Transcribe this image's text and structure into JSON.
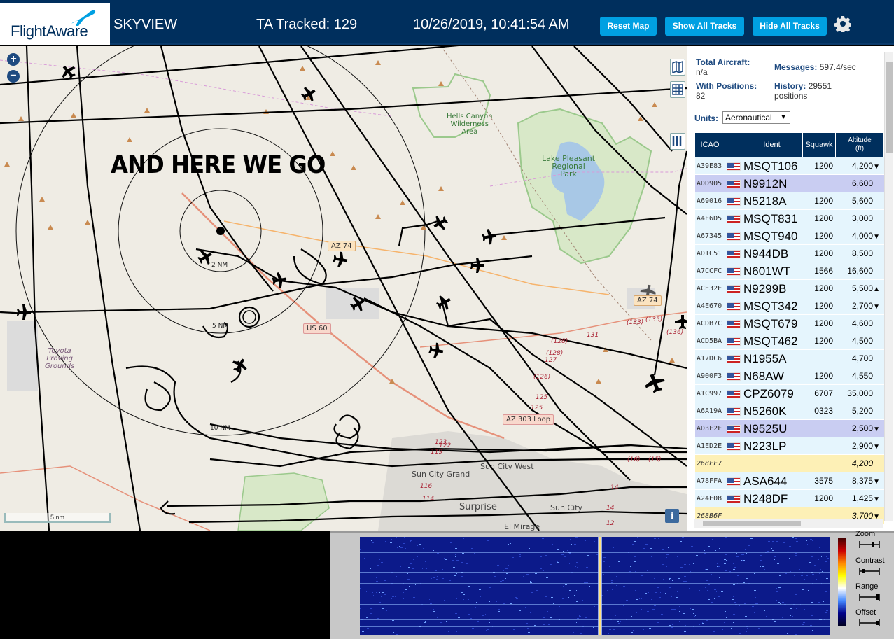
{
  "header": {
    "logo_text": "FlightAware",
    "app_name": "SKYVIEW",
    "tracked": "TA Tracked: 129",
    "clock": "10/26/2019, 10:41:54 AM",
    "btn_reset": "Reset Map",
    "btn_show": "Show All Tracks",
    "btn_hide": "Hide All Tracks",
    "settings_icon": "gear-icon"
  },
  "map": {
    "overlay_text": "AND HERE WE GO",
    "zoom_in": "+",
    "zoom_out": "−",
    "scale_label": "5 nm",
    "info_label": "i",
    "labels": {
      "hells_canyon": "Hells Canyon\nWilderness\nArea",
      "lake_pleasant": "Lake Pleasant\nRegional\nPark",
      "toyota": "Toyota\nProving\nGrounds",
      "sun_city_grand": "Sun City Grand",
      "sun_city_west": "Sun City West",
      "surprise": "Surprise",
      "sun_city": "Sun City",
      "el_mirage": "El Mirage"
    },
    "shields": {
      "az74": "AZ 74",
      "us60": "US 60",
      "az303": "AZ 303 Loop",
      "az74b": "AZ 74"
    },
    "rings": [
      "2 NM",
      "5 NM",
      "10 NM"
    ],
    "exits": [
      "(128)",
      "(128)",
      "127",
      "(126)",
      "125",
      "125",
      "(133)",
      "(135)",
      "(136)",
      "131",
      "123",
      "122",
      "119",
      "116",
      "114",
      "14",
      "14",
      "12",
      "(16)",
      "(15)"
    ]
  },
  "sidebar": {
    "total_aircraft_label": "Total Aircraft:",
    "total_aircraft_value": "n/a",
    "messages_label": "Messages:",
    "messages_value": "597.4/sec",
    "with_positions_label": "With Positions:",
    "with_positions_value": "82",
    "history_label": "History:",
    "history_value": "29551",
    "history_unit": "positions",
    "units_label": "Units:",
    "units_value": "Aeronautical",
    "columns": [
      "ICAO",
      "",
      "Ident",
      "Squawk",
      "Altitude\n(ft)"
    ],
    "rows": [
      {
        "icao": "A39E83",
        "ident": "MSQT106",
        "squawk": "1200",
        "alt": "4,200",
        "trend": "▼",
        "style": ""
      },
      {
        "icao": "ADD905",
        "ident": "N9912N",
        "squawk": "",
        "alt": "6,600",
        "trend": "",
        "style": "sel"
      },
      {
        "icao": "A69016",
        "ident": "N5218A",
        "squawk": "1200",
        "alt": "5,600",
        "trend": "",
        "style": ""
      },
      {
        "icao": "A4F6D5",
        "ident": "MSQT831",
        "squawk": "1200",
        "alt": "3,000",
        "trend": "",
        "style": ""
      },
      {
        "icao": "A67345",
        "ident": "MSQT940",
        "squawk": "1200",
        "alt": "4,000",
        "trend": "▼",
        "style": ""
      },
      {
        "icao": "AD1C51",
        "ident": "N944DB",
        "squawk": "1200",
        "alt": "8,500",
        "trend": "",
        "style": ""
      },
      {
        "icao": "A7CCFC",
        "ident": "N601WT",
        "squawk": "1566",
        "alt": "16,600",
        "trend": "",
        "style": ""
      },
      {
        "icao": "ACE32E",
        "ident": "N9299B",
        "squawk": "1200",
        "alt": "5,500",
        "trend": "▲",
        "style": ""
      },
      {
        "icao": "A4E670",
        "ident": "MSQT342",
        "squawk": "1200",
        "alt": "2,700",
        "trend": "▼",
        "style": ""
      },
      {
        "icao": "ACDB7C",
        "ident": "MSQT679",
        "squawk": "1200",
        "alt": "4,600",
        "trend": "",
        "style": ""
      },
      {
        "icao": "ACD5BA",
        "ident": "MSQT462",
        "squawk": "1200",
        "alt": "4,500",
        "trend": "",
        "style": ""
      },
      {
        "icao": "A17DC6",
        "ident": "N1955A",
        "squawk": "",
        "alt": "4,700",
        "trend": "",
        "style": ""
      },
      {
        "icao": "A900F3",
        "ident": "N68AW",
        "squawk": "1200",
        "alt": "4,550",
        "trend": "",
        "style": ""
      },
      {
        "icao": "A1C997",
        "ident": "CPZ6079",
        "squawk": "6707",
        "alt": "35,000",
        "trend": "",
        "style": ""
      },
      {
        "icao": "A6A19A",
        "ident": "N5260K",
        "squawk": "0323",
        "alt": "5,200",
        "trend": "",
        "style": ""
      },
      {
        "icao": "AD3F2F",
        "ident": "N9525U",
        "squawk": "",
        "alt": "2,500",
        "trend": "▼",
        "style": "sel"
      },
      {
        "icao": "A1ED2E",
        "ident": "N223LP",
        "squawk": "",
        "alt": "2,900",
        "trend": "▼",
        "style": ""
      },
      {
        "icao": "268FF7",
        "ident": "",
        "squawk": "",
        "alt": "4,200",
        "trend": "",
        "style": "mlat"
      },
      {
        "icao": "A78FFA",
        "ident": "ASA644",
        "squawk": "3575",
        "alt": "8,375",
        "trend": "▼",
        "style": ""
      },
      {
        "icao": "A24E08",
        "ident": "N248DF",
        "squawk": "1200",
        "alt": "1,425",
        "trend": "▼",
        "style": ""
      },
      {
        "icao": "268B6F",
        "ident": "",
        "squawk": "",
        "alt": "3,700",
        "trend": "▼",
        "style": "mlat"
      }
    ]
  },
  "sdr": {
    "zoom_label": "Zoom",
    "contrast_label": "Contrast",
    "range_label": "Range",
    "offset_label": "Offset"
  }
}
